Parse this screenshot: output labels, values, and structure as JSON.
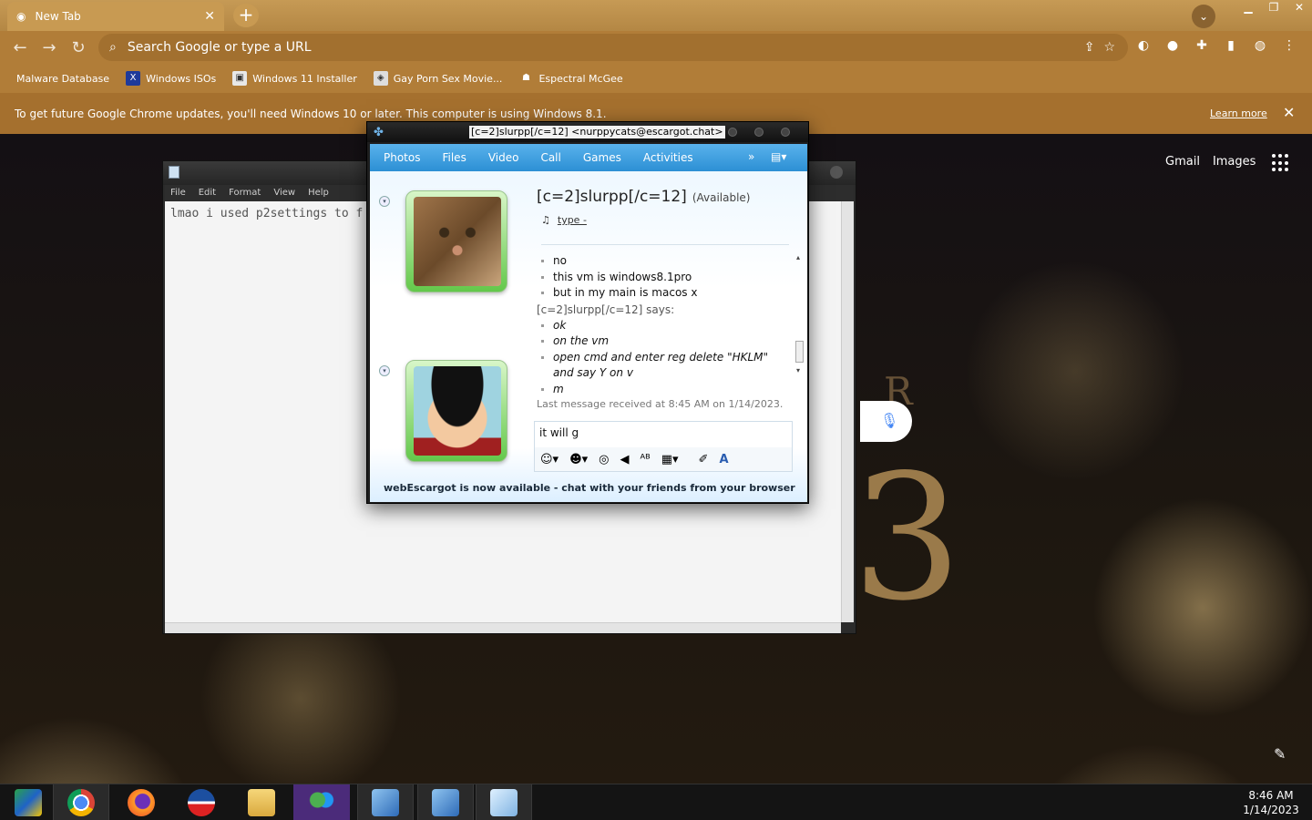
{
  "browser": {
    "tab_title": "New Tab",
    "omnibox_placeholder": "Search Google or type a URL",
    "bookmarks": [
      {
        "label": "Malware Database"
      },
      {
        "label": "Windows ISOs"
      },
      {
        "label": "Windows 11 Installer"
      },
      {
        "label": "Gay Porn Sex Movie..."
      },
      {
        "label": "Espectral McGee"
      }
    ],
    "infobar_text": "To get future Google Chrome updates, you'll need Windows 10 or later. This computer is using Windows 8.1.",
    "infobar_link": "Learn more",
    "theme_color": "#b17d38"
  },
  "ntp": {
    "gmail": "Gmail",
    "images": "Images"
  },
  "notepad": {
    "menu": [
      "File",
      "Edit",
      "Format",
      "View",
      "Help"
    ],
    "content": "lmao i used p2settings to f"
  },
  "messenger": {
    "window_title": "[c=2]slurpp[/c=12] <nurppycats@escargot.chat>",
    "menu": [
      "Photos",
      "Files",
      "Video",
      "Call",
      "Games",
      "Activities"
    ],
    "more": "»",
    "contact_name": "[c=2]slurpp[/c=12]",
    "contact_status": "(Available)",
    "psm_label": "type -",
    "messages_mine": [
      "no",
      "this vm is windows8.1pro",
      "but in my main is macos x"
    ],
    "says_line": "[c=2]slurpp[/c=12] says:",
    "messages_theirs": [
      "ok",
      "on the vm",
      "open cmd and enter reg delete \"HKLM\" and say Y on v",
      "m"
    ],
    "last_received": "Last message received at 8:45 AM on 1/14/2023.",
    "compose_text": "it will g",
    "footer": "webEscargot is now available - chat with your friends from your browser",
    "accent": "#2c8fd4"
  },
  "taskbar": {
    "time": "8:46 AM",
    "date": "1/14/2023"
  }
}
